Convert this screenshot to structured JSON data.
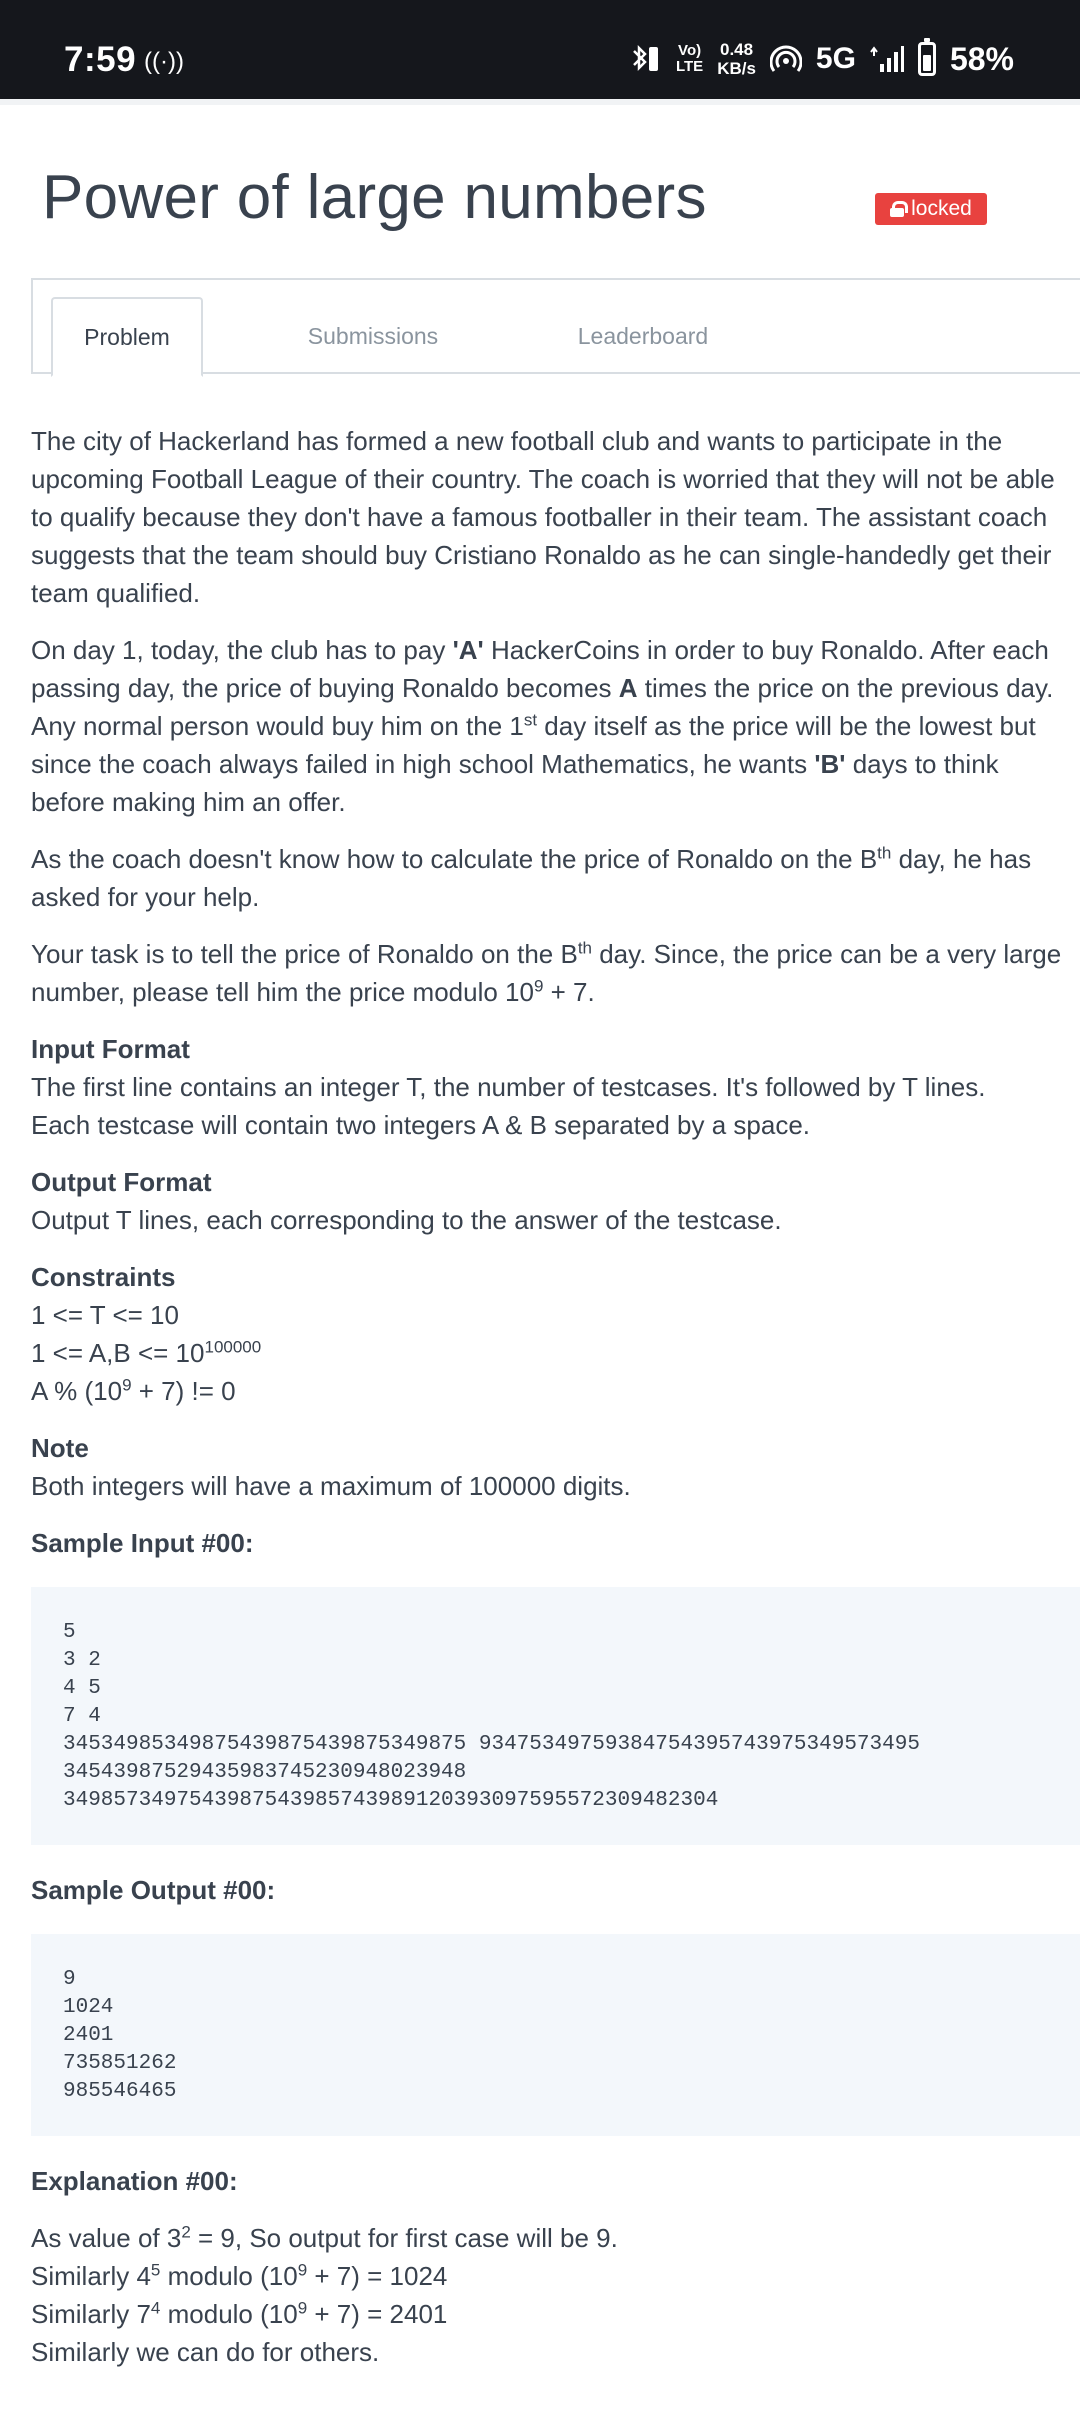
{
  "status_bar": {
    "time": "7:59",
    "cast_symbol": "((·))",
    "bt_icon": "bluetooth-vibrate-icon",
    "volte_top": "Vo)",
    "volte_bottom": "LTE",
    "speed_value": "0.48",
    "speed_unit": "KB/s",
    "network": "5G",
    "battery": "58%"
  },
  "page": {
    "title": "Power of large numbers",
    "badge": "locked"
  },
  "tabs": [
    {
      "label": "Problem",
      "active": true
    },
    {
      "label": "Submissions",
      "active": false
    },
    {
      "label": "Leaderboard",
      "active": false
    }
  ],
  "problem": {
    "p1": "The city of Hackerland has formed a new football club and wants to participate in the upcoming Football League of their country. The coach is worried that they will not be able to qualify because they don't have a famous footballer in their team. The assistant coach suggests that the team should buy Cristiano Ronaldo as he can single-handedly get their team qualified.",
    "p2_a": "On day 1, today, the club has to pay ",
    "p2_b": "'A'",
    "p2_c": " HackerCoins in order to buy Ronaldo. After each passing day, the price of buying Ronaldo becomes ",
    "p2_d": "A",
    "p2_e": " times the price on the previous day. Any normal person would buy him on the 1",
    "p2_sup": "st",
    "p2_f": " day itself as the price will be the lowest but since the coach always failed in high school Mathematics, he wants ",
    "p2_g": "'B'",
    "p2_h": " days to think before making him an offer.",
    "p3_a": "As the coach doesn't know how to calculate the price of Ronaldo on the B",
    "p3_sup": "th",
    "p3_b": " day, he has asked for your help.",
    "p4_a": "Your task is to tell the price of Ronaldo on the B",
    "p4_sup": "th",
    "p4_b": " day. Since, the price can be a very large number, please tell him the price modulo 10",
    "p4_sup2": "9",
    "p4_c": " + 7."
  },
  "input_format": {
    "heading": "Input Format",
    "line1": "The first line contains an integer T, the number of testcases. It's followed by T lines.",
    "line2": "Each testcase will contain two integers A & B separated by a space."
  },
  "output_format": {
    "heading": "Output Format",
    "line1": "Output T lines, each corresponding to the answer of the testcase."
  },
  "constraints": {
    "heading": "Constraints",
    "c1": "1 <= T <= 10",
    "c2_a": "1 <= A,B <= 10",
    "c2_sup": "100000",
    "c3_a": "A % (10",
    "c3_sup": "9",
    "c3_b": " + 7) != 0"
  },
  "note": {
    "heading": "Note",
    "text": "Both integers will have a maximum of 100000 digits."
  },
  "sample_input": {
    "heading": "Sample Input #00:",
    "code": "5\n3 2\n4 5\n7 4\n34534985349875439875439875349875 93475349759384754395743975349573495\n34543987529435983745230948023948\n3498573497543987543985743989120393097595572309482304"
  },
  "sample_output": {
    "heading": "Sample Output #00:",
    "code": "9\n1024\n2401\n735851262\n985546465"
  },
  "explanation": {
    "heading": "Explanation #00:",
    "l1_a": "As value of 3",
    "l1_sup": "2",
    "l1_b": " = 9, So output for first case will be 9.",
    "l2_a": "Similarly 4",
    "l2_sup": "5",
    "l2_b": " modulo (10",
    "l2_sup2": "9",
    "l2_c": " + 7) = 1024",
    "l3_a": "Similarly 7",
    "l3_sup": "4",
    "l3_b": " modulo (10",
    "l3_sup2": "9",
    "l3_c": " + 7) = 2401",
    "l4": "Similarly we can do for others."
  }
}
